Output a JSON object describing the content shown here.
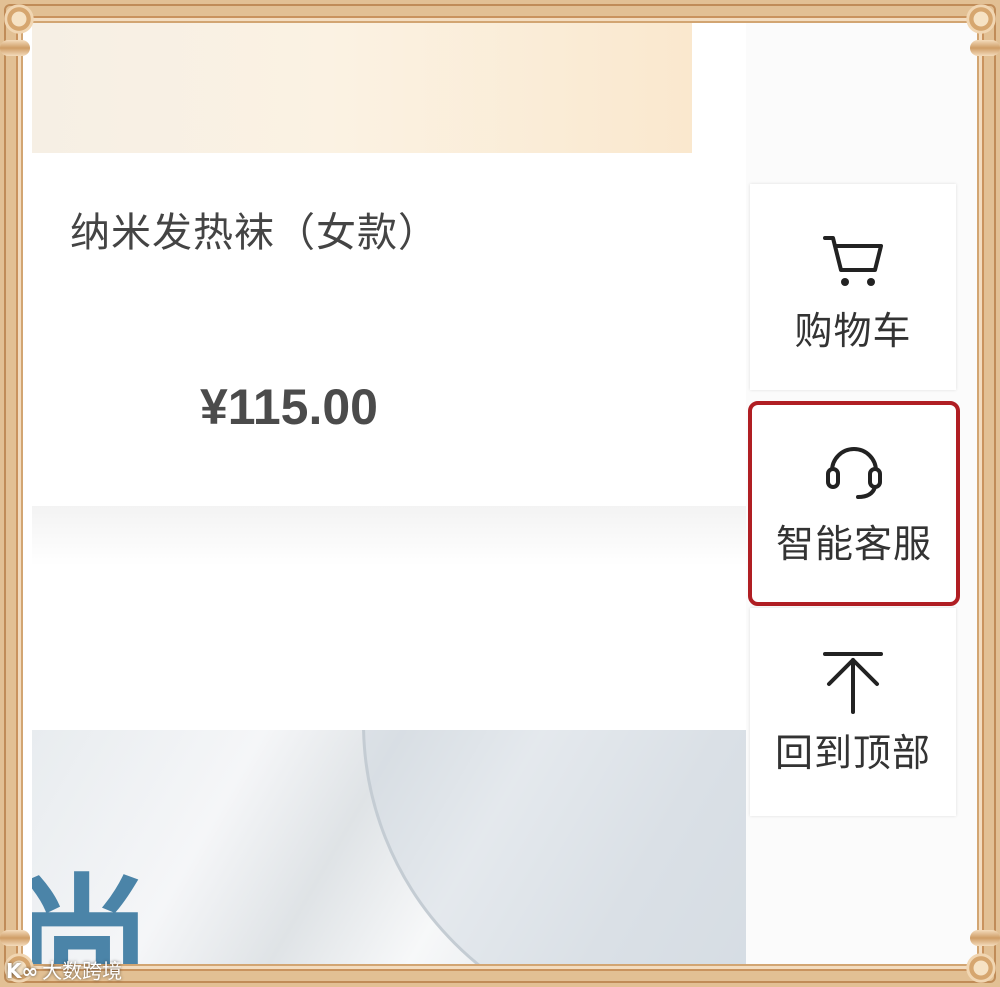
{
  "product": {
    "title": "纳米发热袜（女款）",
    "price": "¥115.00"
  },
  "banner": {
    "glyph": "尚"
  },
  "sidebar": {
    "items": [
      {
        "label": "购物车",
        "icon": "cart-icon"
      },
      {
        "label": "智能客服",
        "icon": "headset-icon",
        "highlighted": true
      },
      {
        "label": "回到顶部",
        "icon": "arrow-up-icon"
      }
    ]
  },
  "highlight_color": "#b01e23",
  "watermark": {
    "logo": "K∞",
    "text": "大数跨境"
  }
}
